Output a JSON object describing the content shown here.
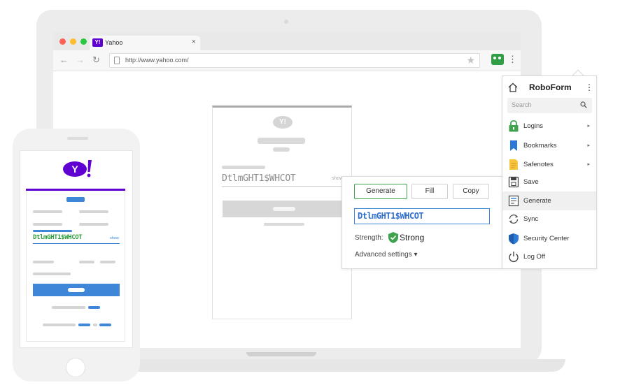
{
  "browser": {
    "tab_title": "Yahoo",
    "tab_favicon": "Y!",
    "tab_close": "×",
    "url": "http://www.yahoo.com/",
    "back": "←",
    "forward": "→",
    "reload": "↻",
    "star": "★",
    "menu": "⋮"
  },
  "login_card": {
    "logo": "Y!",
    "password": "DtlmGHT1$WHCOT",
    "show_label": "show"
  },
  "generator": {
    "generate_label": "Generate",
    "fill_label": "Fill",
    "copy_label": "Copy",
    "password": "DtlmGHT1$WHCOT",
    "strength_label": "Strength:",
    "strength_value": "Strong",
    "advanced_label": "Advanced settings ▾",
    "accent_color": "#3fa34d",
    "output_color": "#2f6fd0"
  },
  "roboform": {
    "title": "RoboForm",
    "menu": "⋮",
    "search_placeholder": "Search",
    "items": [
      {
        "label": "Logins",
        "icon": "lock-icon",
        "arrow": "▸"
      },
      {
        "label": "Bookmarks",
        "icon": "bookmark-icon",
        "arrow": "▸"
      },
      {
        "label": "Safenotes",
        "icon": "note-icon",
        "arrow": "▸"
      },
      {
        "label": "Save",
        "icon": "save-icon",
        "arrow": ""
      },
      {
        "label": "Generate",
        "icon": "generate-icon",
        "arrow": ""
      },
      {
        "label": "Sync",
        "icon": "sync-icon",
        "arrow": ""
      },
      {
        "label": "Security Center",
        "icon": "shield-icon",
        "arrow": ""
      },
      {
        "label": "Log Off",
        "icon": "power-icon",
        "arrow": ""
      }
    ]
  },
  "phone": {
    "logo": "Y!",
    "password": "DtlmGHT1$WHCOT",
    "show_label": "show",
    "brand_color": "#5f01d1"
  }
}
